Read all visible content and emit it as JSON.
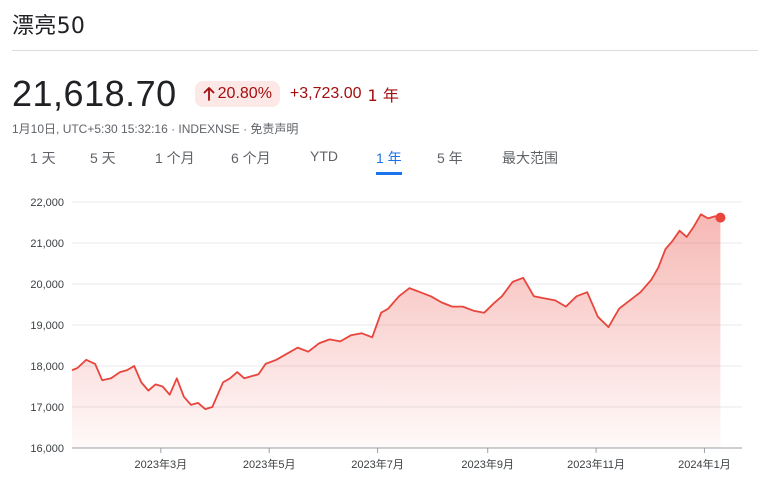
{
  "header": {
    "title": "漂亮50"
  },
  "quote": {
    "price": "21,618.70",
    "pct_change": "20.80%",
    "abs_change": "+3,723.00",
    "period": "1 年",
    "meta": "1月10日, UTC+5:30 15:32:16 · INDEXNSE · 免责声明"
  },
  "tabs": [
    {
      "label": "1 天"
    },
    {
      "label": "5 天"
    },
    {
      "label": "1 个月"
    },
    {
      "label": "6 个月"
    },
    {
      "label": "YTD"
    },
    {
      "label": "1 年",
      "active": true
    },
    {
      "label": "5 年"
    },
    {
      "label": "最大范围"
    }
  ],
  "colors": {
    "accent": "#1a73e8",
    "down_text": "#a50e0e",
    "line": "#e8453c",
    "badge_bg": "#fce8e6"
  },
  "icons": {
    "change_arrow": "arrow-up-icon"
  },
  "chart_data": {
    "type": "area",
    "ylim": [
      16000,
      22000
    ],
    "y_ticks": [
      16000,
      17000,
      18000,
      19000,
      20000,
      21000,
      22000
    ],
    "y_tick_labels": [
      "16,000",
      "17,000",
      "18,000",
      "19,000",
      "20,000",
      "21,000",
      "22,000"
    ],
    "x_ticks": [
      {
        "date": "2023-03-01",
        "label": "2023年3月"
      },
      {
        "date": "2023-05-01",
        "label": "2023年5月"
      },
      {
        "date": "2023-07-01",
        "label": "2023年7月"
      },
      {
        "date": "2023-09-01",
        "label": "2023年9月"
      },
      {
        "date": "2023-11-01",
        "label": "2023年11月"
      },
      {
        "date": "2024-01-01",
        "label": "2024年1月"
      }
    ],
    "x_range": [
      "2023-01-10",
      "2024-01-12"
    ],
    "grid": true,
    "series": [
      {
        "x": [
          "2023-01-10",
          "2023-01-13",
          "2023-01-18",
          "2023-01-23",
          "2023-01-27",
          "2023-02-01",
          "2023-02-06",
          "2023-02-10",
          "2023-02-14",
          "2023-02-18",
          "2023-02-22",
          "2023-02-26",
          "2023-03-02",
          "2023-03-06",
          "2023-03-10",
          "2023-03-14",
          "2023-03-18",
          "2023-03-22",
          "2023-03-26",
          "2023-03-30",
          "2023-04-05",
          "2023-04-09",
          "2023-04-13",
          "2023-04-17",
          "2023-04-21",
          "2023-04-25",
          "2023-04-29",
          "2023-05-05",
          "2023-05-11",
          "2023-05-17",
          "2023-05-23",
          "2023-05-29",
          "2023-06-04",
          "2023-06-10",
          "2023-06-16",
          "2023-06-22",
          "2023-06-28",
          "2023-07-03",
          "2023-07-07",
          "2023-07-13",
          "2023-07-19",
          "2023-07-25",
          "2023-07-31",
          "2023-08-06",
          "2023-08-12",
          "2023-08-18",
          "2023-08-24",
          "2023-08-30",
          "2023-09-05",
          "2023-09-09",
          "2023-09-15",
          "2023-09-21",
          "2023-09-27",
          "2023-10-03",
          "2023-10-09",
          "2023-10-15",
          "2023-10-21",
          "2023-10-27",
          "2023-11-02",
          "2023-11-08",
          "2023-11-14",
          "2023-11-20",
          "2023-11-26",
          "2023-12-02",
          "2023-12-06",
          "2023-12-10",
          "2023-12-14",
          "2023-12-18",
          "2023-12-22",
          "2023-12-26",
          "2023-12-30",
          "2024-01-03",
          "2024-01-07",
          "2024-01-10"
        ],
        "y": [
          17900,
          17950,
          18150,
          18050,
          17650,
          17700,
          17850,
          17900,
          18000,
          17600,
          17400,
          17550,
          17500,
          17300,
          17700,
          17250,
          17050,
          17100,
          16950,
          17000,
          17600,
          17700,
          17850,
          17700,
          17750,
          17800,
          18050,
          18150,
          18300,
          18450,
          18350,
          18550,
          18650,
          18600,
          18750,
          18800,
          18700,
          19300,
          19400,
          19700,
          19900,
          19800,
          19700,
          19550,
          19450,
          19450,
          19350,
          19300,
          19550,
          19700,
          20050,
          20150,
          19700,
          19650,
          19600,
          19450,
          19700,
          19800,
          19200,
          18950,
          19400,
          19600,
          19800,
          20100,
          20400,
          20850,
          21050,
          21300,
          21150,
          21400,
          21700,
          21600,
          21650,
          21618.7
        ]
      }
    ]
  }
}
